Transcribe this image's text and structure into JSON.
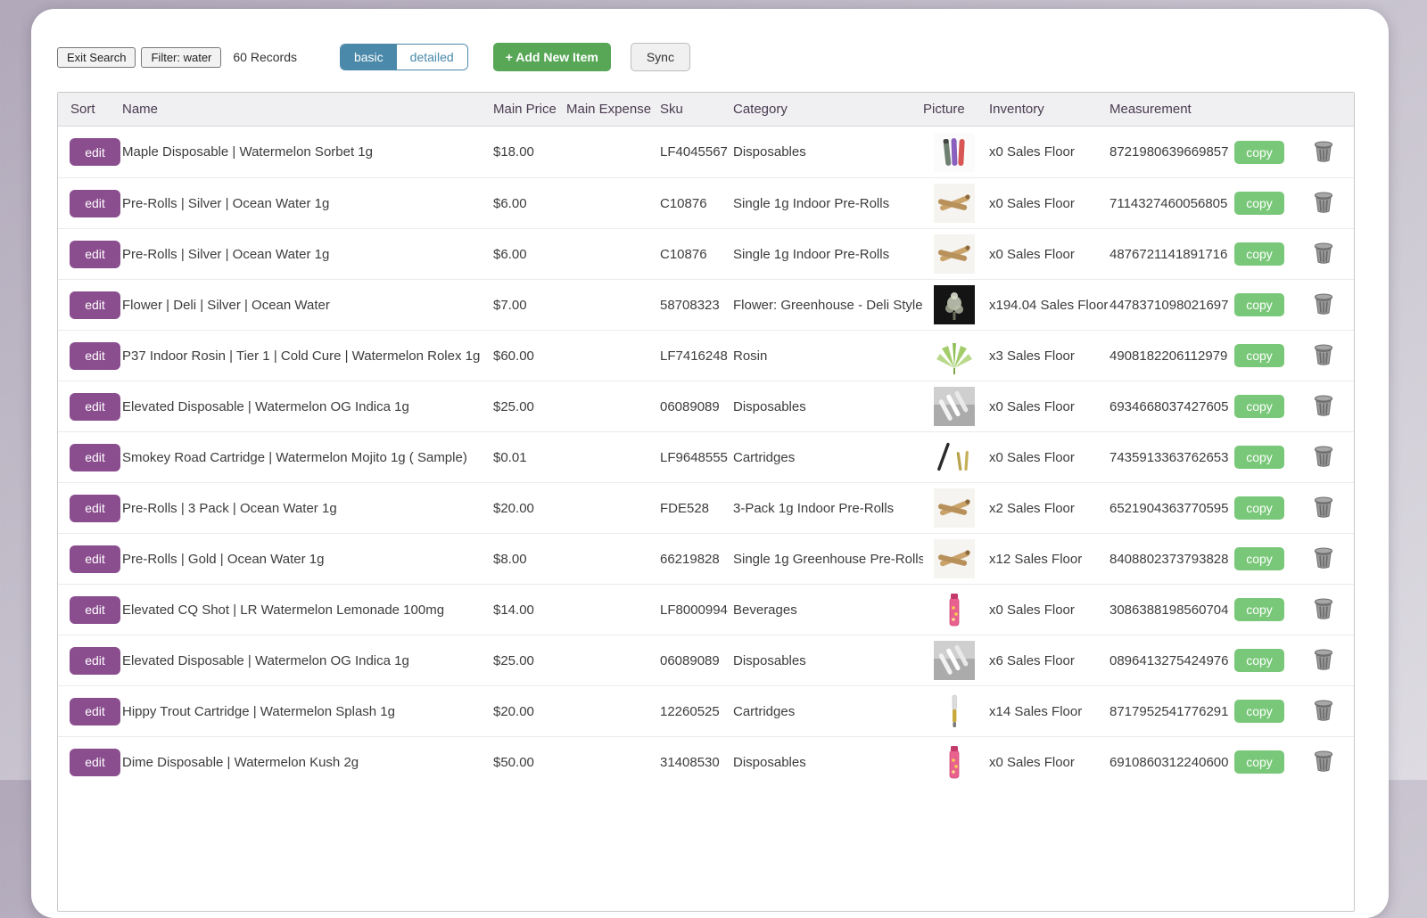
{
  "toolbar": {
    "exit_search_label": "Exit Search",
    "filter_label": "Filter: water",
    "records_count": "60 Records",
    "view_toggle": {
      "basic_label": "basic",
      "detailed_label": "detailed",
      "active": "basic"
    },
    "add_new_item_label": "+ Add New Item",
    "sync_label": "Sync"
  },
  "colors": {
    "edit_button": "#8a4d8e",
    "copy_button": "#79c879",
    "add_button": "#57a757",
    "toggle_active": "#4a89a9",
    "header_text": "#4a3d52"
  },
  "table": {
    "headers": [
      "Sort",
      "Name",
      "Main Price",
      "Main Expense",
      "Sku",
      "Category",
      "Picture",
      "Inventory",
      "Measurement"
    ],
    "edit_label": "edit",
    "copy_label": "copy",
    "rows": [
      {
        "name": "Maple Disposable | Watermelon Sorbet 1g",
        "main_price": "$18.00",
        "main_expense": "",
        "sku": "LF4045567",
        "category": "Disposables",
        "picture": "colored-vape-pens",
        "inventory": "x0 Sales Floor",
        "measurement": "8721980639669857"
      },
      {
        "name": "Pre-Rolls | Silver | Ocean Water 1g",
        "main_price": "$6.00",
        "main_expense": "",
        "sku": "C10876",
        "category": "Single 1g Indoor Pre-Rolls",
        "picture": "crossed-pre-rolls",
        "inventory": "x0 Sales Floor",
        "measurement": "7114327460056805"
      },
      {
        "name": "Pre-Rolls | Silver | Ocean Water 1g",
        "main_price": "$6.00",
        "main_expense": "",
        "sku": "C10876",
        "category": "Single 1g Indoor Pre-Rolls",
        "picture": "crossed-pre-rolls",
        "inventory": "x0 Sales Floor",
        "measurement": "4876721141891716"
      },
      {
        "name": "Flower | Deli | Silver | Ocean Water",
        "main_price": "$7.00",
        "main_expense": "",
        "sku": "58708323",
        "category": "Flower: Greenhouse - Deli Style",
        "picture": "dark-flower-bud",
        "inventory": "x194.04 Sales Floor",
        "measurement": "4478371098021697"
      },
      {
        "name": "P37 Indoor Rosin | Tier 1 | Cold Cure | Watermelon Rolex 1g",
        "main_price": "$60.00",
        "main_expense": "",
        "sku": "LF7416248",
        "category": "Rosin",
        "picture": "green-leaf",
        "inventory": "x3 Sales Floor",
        "measurement": "4908182206112979"
      },
      {
        "name": "Elevated Disposable | Watermelon OG Indica 1g",
        "main_price": "$25.00",
        "main_expense": "",
        "sku": "06089089",
        "category": "Disposables",
        "picture": "gray-vape-pens",
        "inventory": "x0 Sales Floor",
        "measurement": "6934668037427605"
      },
      {
        "name": "Smokey Road Cartridge | Watermelon Mojito 1g ( Sample)",
        "main_price": "$0.01",
        "main_expense": "",
        "sku": "LF9648555",
        "category": "Cartridges",
        "picture": "cartridges",
        "inventory": "x0 Sales Floor",
        "measurement": "7435913363762653"
      },
      {
        "name": "Pre-Rolls | 3 Pack | Ocean Water 1g",
        "main_price": "$20.00",
        "main_expense": "",
        "sku": "FDE528",
        "category": "3-Pack 1g Indoor Pre-Rolls",
        "picture": "crossed-pre-rolls",
        "inventory": "x2 Sales Floor",
        "measurement": "6521904363770595"
      },
      {
        "name": "Pre-Rolls | Gold | Ocean Water 1g",
        "main_price": "$8.00",
        "main_expense": "",
        "sku": "66219828",
        "category": "Single 1g Greenhouse Pre-Rolls",
        "picture": "crossed-pre-rolls",
        "inventory": "x12 Sales Floor",
        "measurement": "8408802373793828"
      },
      {
        "name": "Elevated CQ Shot | LR Watermelon Lemonade 100mg",
        "main_price": "$14.00",
        "main_expense": "",
        "sku": "LF8000994",
        "category": "Beverages",
        "picture": "pink-beverage-bottle",
        "inventory": "x0 Sales Floor",
        "measurement": "3086388198560704"
      },
      {
        "name": "Elevated Disposable | Watermelon OG Indica 1g",
        "main_price": "$25.00",
        "main_expense": "",
        "sku": "06089089",
        "category": "Disposables",
        "picture": "gray-vape-pens",
        "inventory": "x6 Sales Floor",
        "measurement": "0896413275424976"
      },
      {
        "name": "Hippy Trout Cartridge | Watermelon Splash 1g",
        "main_price": "$20.00",
        "main_expense": "",
        "sku": "12260525",
        "category": "Cartridges",
        "picture": "thin-cartridge",
        "inventory": "x14 Sales Floor",
        "measurement": "8717952541776291"
      },
      {
        "name": "Dime Disposable | Watermelon Kush 2g",
        "main_price": "$50.00",
        "main_expense": "",
        "sku": "31408530",
        "category": "Disposables",
        "picture": "pink-beverage-bottle",
        "inventory": "x0 Sales Floor",
        "measurement": "6910860312240600"
      }
    ]
  }
}
